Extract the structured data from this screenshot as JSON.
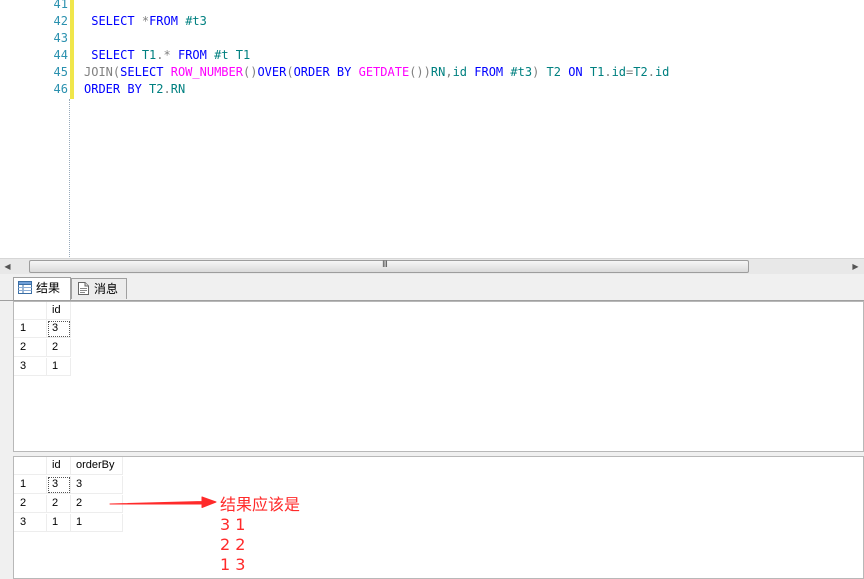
{
  "editor": {
    "lines": [
      {
        "num": "41",
        "code": []
      },
      {
        "num": "42",
        "code": [
          {
            "t": " ",
            "c": ""
          },
          {
            "t": "SELECT",
            "c": "kw"
          },
          {
            "t": " ",
            "c": ""
          },
          {
            "t": "*",
            "c": "gr"
          },
          {
            "t": "FROM",
            "c": "kw"
          },
          {
            "t": " #t3",
            "c": "id"
          }
        ]
      },
      {
        "num": "43",
        "code": []
      },
      {
        "num": "44",
        "code": [
          {
            "t": " ",
            "c": ""
          },
          {
            "t": "SELECT",
            "c": "kw"
          },
          {
            "t": " T1",
            "c": "id"
          },
          {
            "t": ".*",
            "c": "gr"
          },
          {
            "t": " ",
            "c": ""
          },
          {
            "t": "FROM",
            "c": "kw"
          },
          {
            "t": " #t T1",
            "c": "id"
          }
        ]
      },
      {
        "num": "45",
        "code": [
          {
            "t": "JOIN",
            "c": "gr"
          },
          {
            "t": "(",
            "c": "gr"
          },
          {
            "t": "SELECT",
            "c": "kw"
          },
          {
            "t": " ",
            "c": ""
          },
          {
            "t": "ROW_NUMBER",
            "c": "fn"
          },
          {
            "t": "()",
            "c": "gr"
          },
          {
            "t": "OVER",
            "c": "kw"
          },
          {
            "t": "(",
            "c": "gr"
          },
          {
            "t": "ORDER BY",
            "c": "kw"
          },
          {
            "t": " ",
            "c": ""
          },
          {
            "t": "GETDATE",
            "c": "fn"
          },
          {
            "t": "())",
            "c": "gr"
          },
          {
            "t": "RN",
            "c": "id"
          },
          {
            "t": ",",
            "c": "gr"
          },
          {
            "t": "id",
            "c": "id"
          },
          {
            "t": " ",
            "c": ""
          },
          {
            "t": "FROM",
            "c": "kw"
          },
          {
            "t": " #t3",
            "c": "id"
          },
          {
            "t": ")",
            "c": "gr"
          },
          {
            "t": " T2 ",
            "c": "id"
          },
          {
            "t": "ON",
            "c": "kw"
          },
          {
            "t": " T1",
            "c": "id"
          },
          {
            "t": ".",
            "c": "gr"
          },
          {
            "t": "id",
            "c": "id"
          },
          {
            "t": "=",
            "c": "gr"
          },
          {
            "t": "T2",
            "c": "id"
          },
          {
            "t": ".",
            "c": "gr"
          },
          {
            "t": "id",
            "c": "id"
          }
        ]
      },
      {
        "num": "46",
        "code": [
          {
            "t": "ORDER BY",
            "c": "kw"
          },
          {
            "t": " T2",
            "c": "id"
          },
          {
            "t": ".",
            "c": "gr"
          },
          {
            "t": "RN",
            "c": "id"
          }
        ]
      }
    ]
  },
  "scrollbar": {
    "grip": "III",
    "left_arrow": "◀",
    "right_arrow": "▶"
  },
  "tabs": {
    "results_label": "结果",
    "messages_label": "消息"
  },
  "grid1": {
    "columns": [
      "id"
    ],
    "rows": [
      {
        "row_num": "1",
        "cells": [
          "3"
        ]
      },
      {
        "row_num": "2",
        "cells": [
          "2"
        ]
      },
      {
        "row_num": "3",
        "cells": [
          "1"
        ]
      }
    ]
  },
  "grid2": {
    "columns": [
      "id",
      "orderBy"
    ],
    "rows": [
      {
        "row_num": "1",
        "cells": [
          "3",
          "3"
        ]
      },
      {
        "row_num": "2",
        "cells": [
          "2",
          "2"
        ]
      },
      {
        "row_num": "3",
        "cells": [
          "1",
          "1"
        ]
      }
    ]
  },
  "annotation": {
    "heading": "结果应该是",
    "lines": [
      "3 1",
      "2 2",
      "1 3"
    ],
    "color": "#ff2a2a"
  }
}
